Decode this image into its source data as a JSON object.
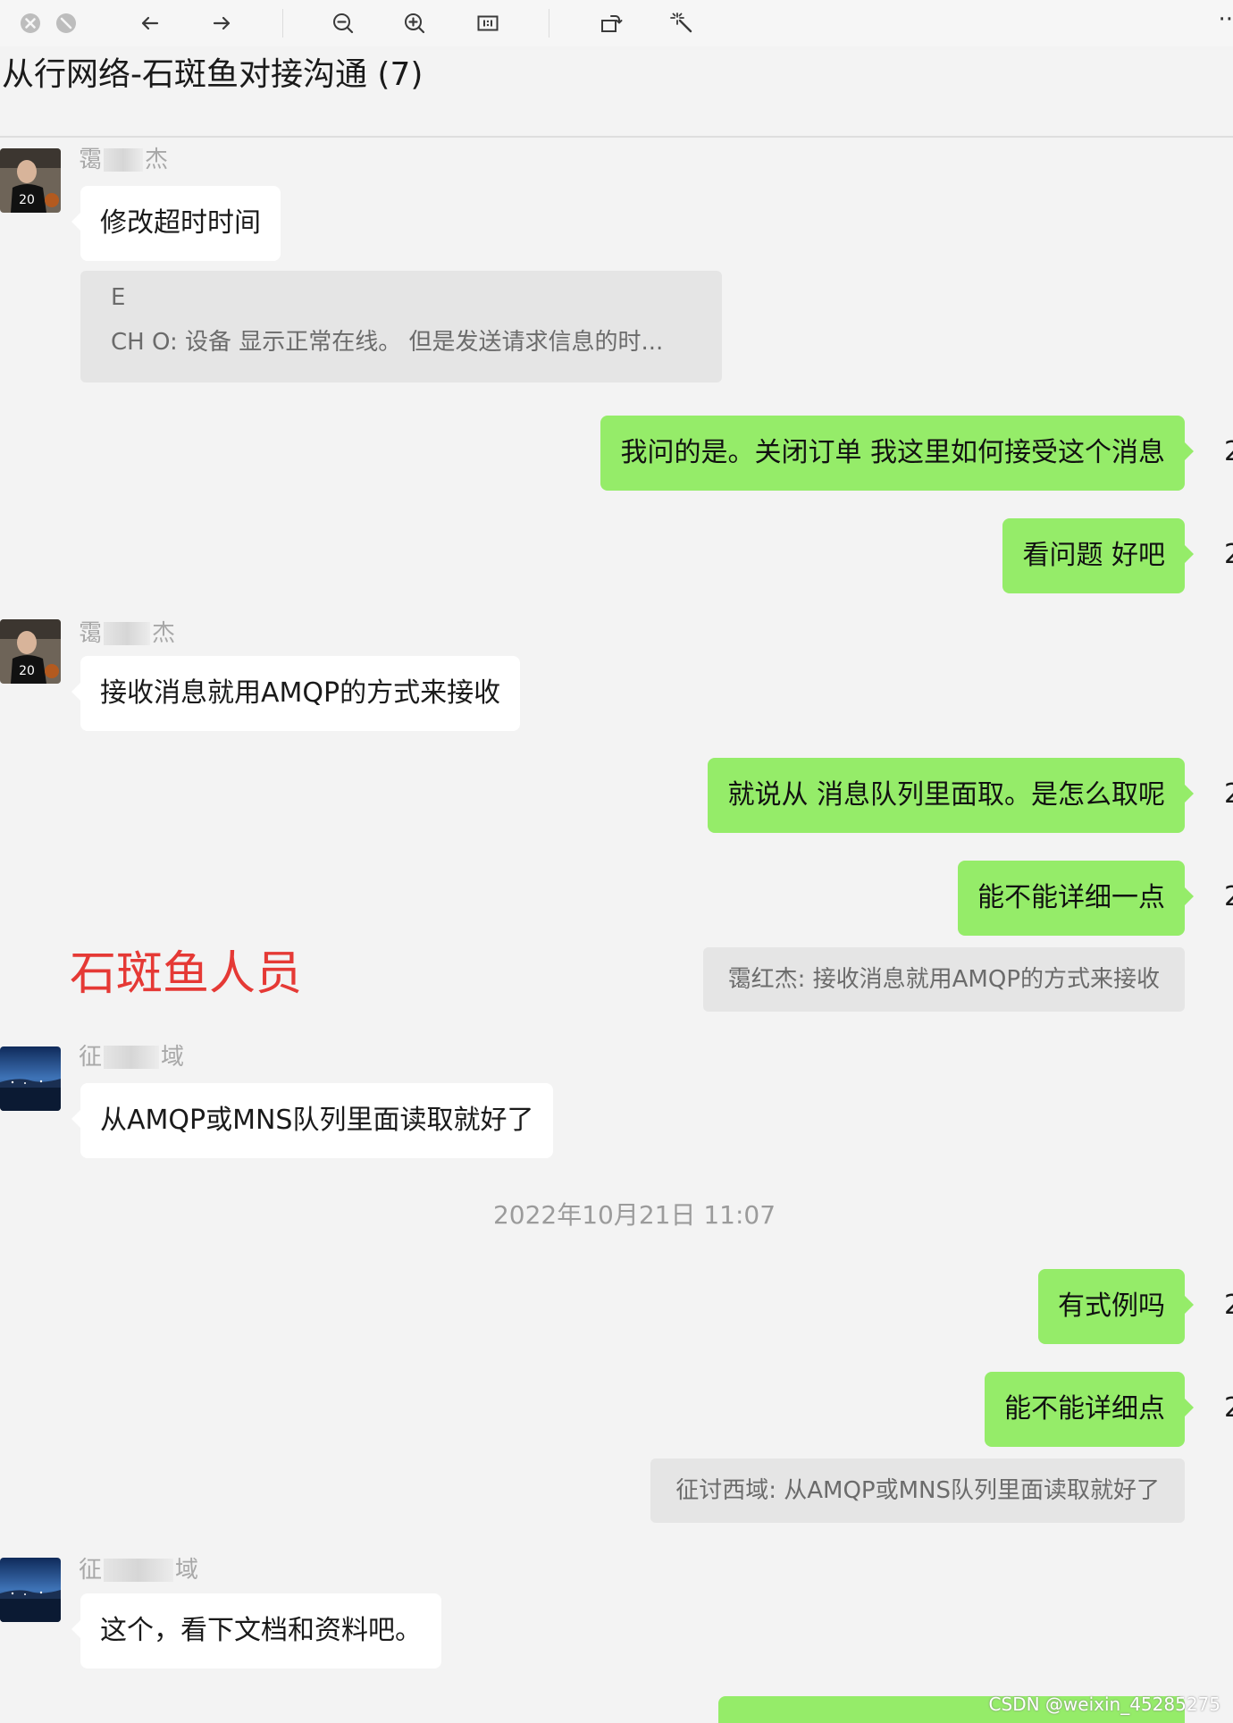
{
  "toolbar": {
    "buttons": [
      {
        "icon": "close-icon"
      },
      {
        "icon": "stop-icon"
      },
      {
        "icon": "arrow-left-icon"
      },
      {
        "icon": "arrow-right-icon"
      },
      {
        "icon": "zoom-out-icon"
      },
      {
        "icon": "zoom-in-icon"
      },
      {
        "icon": "actual-size-icon"
      },
      {
        "icon": "rotate-icon"
      },
      {
        "icon": "magic-wand-icon"
      }
    ],
    "more_label": "··"
  },
  "chat": {
    "title": "从行网络-石斑鱼对接沟通 (7)",
    "messages": [
      {
        "type": "in",
        "sender": {
          "first": "霭",
          "last": "杰"
        },
        "text": "修改超时时间"
      },
      {
        "type": "quote",
        "line1": "E",
        "line2": "CH O: 设备 显示正常在线。 但是发送请求信息的时..."
      },
      {
        "type": "out",
        "text": "我问的是。关闭订单 我这里如何接受这个消息"
      },
      {
        "type": "out",
        "text": "看问题 好吧"
      },
      {
        "type": "in",
        "sender": {
          "first": "霭",
          "last": "杰"
        },
        "text": "接收消息就用AMQP的方式来接收"
      },
      {
        "type": "out",
        "text": "就说从 消息队列里面取。是怎么取呢"
      },
      {
        "type": "out",
        "text": "能不能详细一点"
      },
      {
        "type": "reply_quote",
        "text": "霭红杰: 接收消息就用AMQP的方式来接收"
      },
      {
        "type": "in",
        "sender": {
          "first": "征",
          "last": "域"
        },
        "text": "从AMQP或MNS队列里面读取就好了"
      },
      {
        "type": "time",
        "text": "2022年10月21日 11:07"
      },
      {
        "type": "out",
        "text": "有式例吗"
      },
      {
        "type": "out",
        "text": "能不能详细点"
      },
      {
        "type": "reply_quote",
        "text": "征讨西域: 从AMQP或MNS队列里面读取就好了"
      },
      {
        "type": "in",
        "sender": {
          "first": "征",
          "last": "域"
        },
        "text": "这个，看下文档和资料吧。"
      }
    ]
  },
  "annotation": "石斑鱼人员",
  "watermark": "CSDN @weixin_45285275",
  "colors": {
    "outgoing_bubble": "#95ec69",
    "incoming_bubble": "#ffffff",
    "annotation": "#e53935",
    "background": "#f3f3f3"
  }
}
